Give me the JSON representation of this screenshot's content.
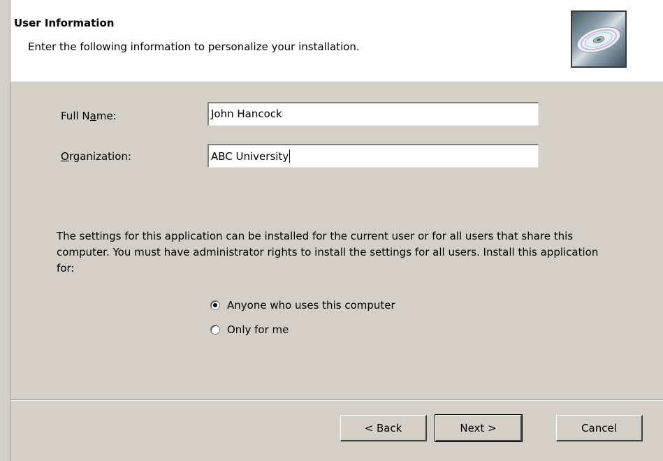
{
  "header": {
    "title": "User Information",
    "subtitle": "Enter the following information to personalize your installation.",
    "icon": "cd-disc-icon"
  },
  "form": {
    "full_name": {
      "label_pre": "Full N",
      "label_accel": "a",
      "label_post": "me:",
      "value": "John Hancock"
    },
    "organization": {
      "label_pre": "",
      "label_accel": "O",
      "label_post": "rganization:",
      "value": "ABC University"
    }
  },
  "install_for": {
    "description": "The settings for this application can be installed for the current user or for all users that share this computer. You must have administrator rights to install the settings for all users. Install this application for:",
    "options": [
      {
        "label": "Anyone who uses this computer",
        "selected": true
      },
      {
        "label": "Only for me",
        "selected": false
      }
    ]
  },
  "buttons": {
    "back": "< Back",
    "next": "Next >",
    "cancel": "Cancel"
  }
}
